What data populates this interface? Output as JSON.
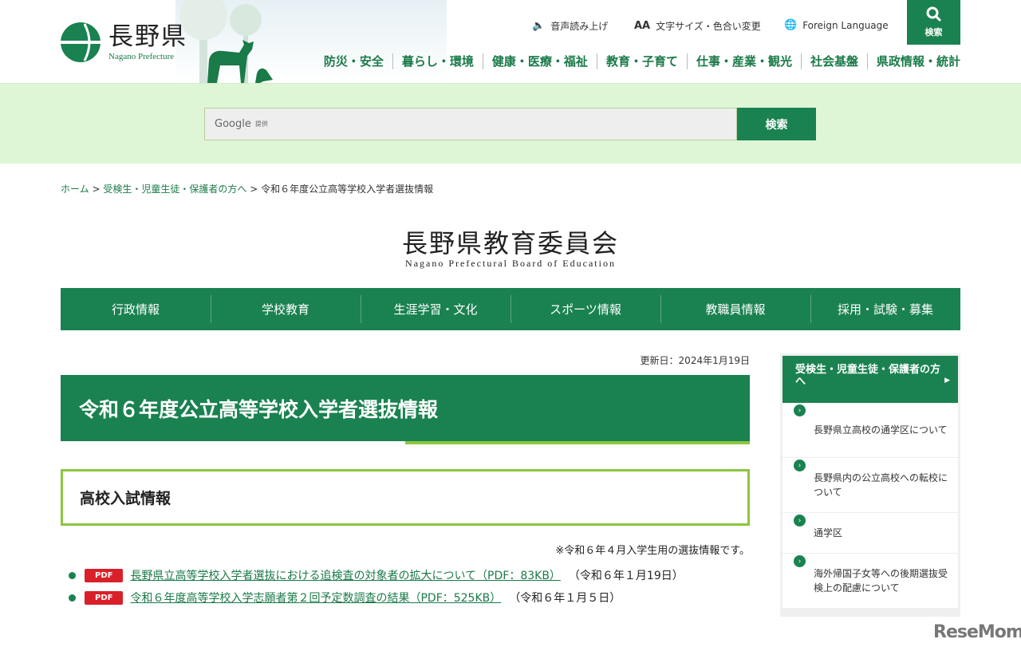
{
  "header": {
    "logo_jp": "長野県",
    "logo_en": "Nagano Prefecture",
    "utils": [
      {
        "icon": "speaker-icon",
        "label": "音声読み上げ"
      },
      {
        "icon": "font-size-icon",
        "label": "文字サイズ・色合い変更"
      },
      {
        "icon": "globe-icon",
        "label": "Foreign Language"
      }
    ],
    "search_label": "検索",
    "gnav": [
      "防災・安全",
      "暮らし・環境",
      "健康・医療・福祉",
      "教育・子育て",
      "仕事・産業・観光",
      "社会基盤",
      "県政情報・統計"
    ]
  },
  "search": {
    "placeholder_brand": "Google",
    "placeholder_suffix": "提供",
    "button": "検索"
  },
  "breadcrumb": {
    "items": [
      "ホーム",
      "受検生・児童生徒・保護者の方へ"
    ],
    "sep": ">",
    "current": "令和６年度公立高等学校入学者選抜情報"
  },
  "board": {
    "jp": "長野県教育委員会",
    "en": "Nagano Prefectural Board of Education"
  },
  "main_nav": [
    "行政情報",
    "学校教育",
    "生涯学習・文化",
    "スポーツ情報",
    "教職員情報",
    "採用・試験・募集"
  ],
  "page": {
    "updated": "更新日：2024年1月19日",
    "title": "令和６年度公立高等学校入学者選抜情報",
    "section": "高校入試情報",
    "note": "※令和６年４月入学生用の選抜情報です。",
    "docs": [
      {
        "badge": "PDF",
        "link": "長野県立高等学校入学者選抜における追検査の対象者の拡大について（PDF：83KB）",
        "date": "（令和６年１月19日）"
      },
      {
        "badge": "PDF",
        "link": "令和６年度高等学校入学志願者第２回予定数調査の結果（PDF：525KB）",
        "date": "（令和６年１月５日）"
      }
    ]
  },
  "sidebar": {
    "heading": "受検生・児童生徒・保護者の方へ",
    "items": [
      "長野県立高校の通学区について",
      "長野県内の公立高校への転校について",
      "通学区",
      "海外帰国子女等への後期選抜受検上の配慮について"
    ]
  },
  "watermark": "ReseMom",
  "colors": {
    "primary": "#1a8250",
    "accent": "#8dc63f",
    "band": "#def6d6",
    "pdf": "#d9202a"
  }
}
